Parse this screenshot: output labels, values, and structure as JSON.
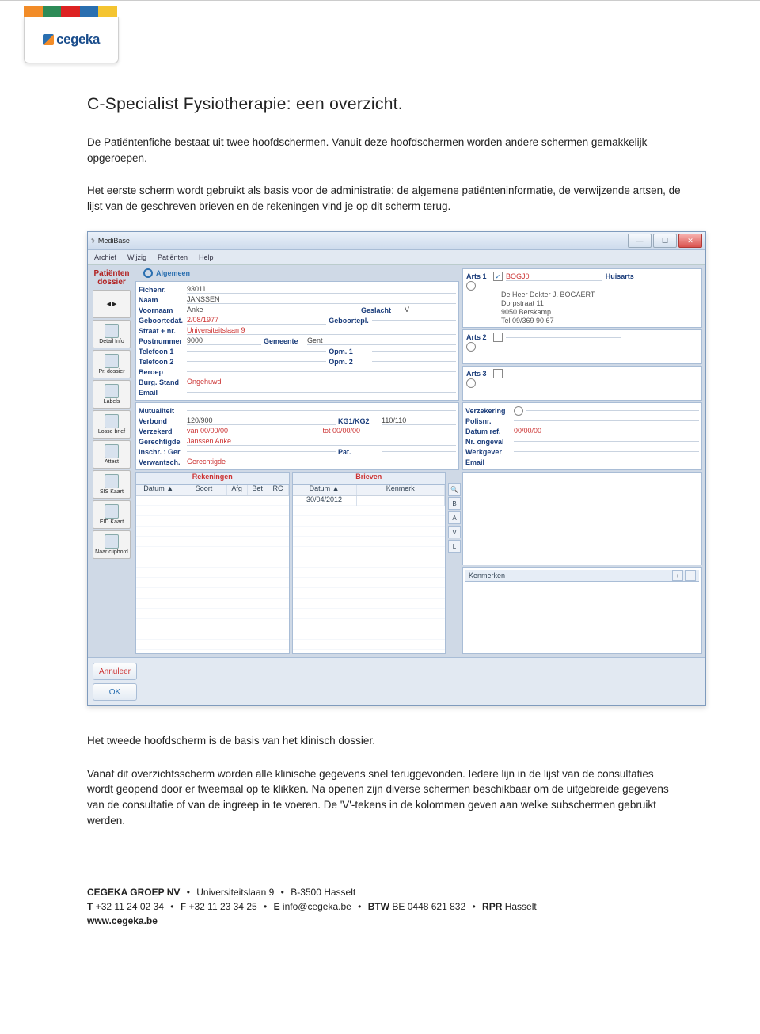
{
  "header": {
    "brand": "cegeka"
  },
  "document": {
    "title": "C-Specialist Fysiotherapie: een overzicht.",
    "intro": "De Patiëntenfiche bestaat uit twee hoofdschermen. Vanuit deze hoofdschermen worden andere schermen gemakkelijk opgeroepen.",
    "para": "Het eerste scherm wordt gebruikt als basis voor de administratie: de algemene patiënteninformatie, de verwijzende artsen, de lijst van de geschreven brieven en de rekeningen vind je op dit scherm terug.",
    "after1": "Het tweede hoofdscherm is de basis van het klinisch dossier.",
    "after2": "Vanaf dit overzichtsscherm worden alle klinische gegevens snel teruggevonden. Iedere lijn in de lijst van de consultaties wordt geopend door er tweemaal op te klikken. Na openen zijn diverse schermen beschikbaar om de uitgebreide gegevens van de consultatie of van de ingreep in te voeren. De 'V'-tekens in de kolommen geven aan welke subschermen gebruikt werden."
  },
  "footer": {
    "company": "CEGEKA GROEP NV",
    "address": "Universiteitslaan 9",
    "city": "B-3500 Hasselt",
    "phone_label": "T",
    "phone": "+32 11 24 02 34",
    "fax_label": "F",
    "fax": "+32 11 23 34 25",
    "email_label": "E",
    "email": "info@cegeka.be",
    "vat_label": "BTW",
    "vat": "BE 0448 621 832",
    "rpr_label": "RPR",
    "rpr": "Hasselt",
    "web": "www.cegeka.be"
  },
  "app": {
    "title": "MediBase",
    "menus": [
      "Archief",
      "Wijzig",
      "Patiënten",
      "Help"
    ],
    "rail_title": "Patiëntendossier",
    "rail": [
      "◀ ▶",
      "Detail Info",
      "Pr. dossier",
      "Labels",
      "Losse brief",
      "Attest",
      "SIS Kaart",
      "EID Kaart",
      "Naar clipbord"
    ],
    "section_general": "Algemeen",
    "form": {
      "fichenr_label": "Fichenr.",
      "fichenr": "93011",
      "naam_label": "Naam",
      "naam": "JANSSEN",
      "voornaam_label": "Voornaam",
      "voornaam": "Anke",
      "geslacht_label": "Geslacht",
      "geslacht": "V",
      "geboortedat_label": "Geboortedat.",
      "geboortedat": "2/08/1977",
      "geboortepl_label": "Geboortepl.",
      "geboortepl": "",
      "straat_label": "Straat + nr.",
      "straat": "Universiteitslaan 9",
      "postnummer_label": "Postnummer",
      "postnummer": "9000",
      "gemeente_label": "Gemeente",
      "gemeente": "Gent",
      "tel1_label": "Telefoon 1",
      "tel1": "",
      "opm1_label": "Opm. 1",
      "tel2_label": "Telefoon 2",
      "tel2": "",
      "opm2_label": "Opm. 2",
      "beroep_label": "Beroep",
      "burg_label": "Burg. Stand",
      "burg": "Ongehuwd",
      "email_label": "Email",
      "mutualiteit_label": "Mutualiteit",
      "verbond_label": "Verbond",
      "verbond": "120/900",
      "kg1_label": "KG1/KG2",
      "kg1": "110/110",
      "verzekerd_label": "Verzekerd",
      "verzekerd_van": "van  00/00/00",
      "verzekerd_tot": "tot  00/00/00",
      "gerechtigde_label": "Gerechtigde",
      "gerechtigde": "Janssen Anke",
      "inschr_label": "Inschr. : Ger",
      "pat_label": "Pat.",
      "verwantsch_label": "Verwantsch.",
      "verpeoples": "Gerechtigde"
    },
    "tables": {
      "rekeningen": {
        "title": "Rekeningen",
        "cols": [
          "Datum ▲",
          "Soort",
          "Afg",
          "Bet",
          "RC"
        ]
      },
      "brieven": {
        "title": "Brieven",
        "cols": [
          "Datum ▲",
          "Kenmerk"
        ],
        "row_date": "30/04/2012"
      },
      "side_buttons": [
        "🔍",
        "B",
        "A",
        "V",
        "L"
      ]
    },
    "doctors": {
      "arts1_label": "Arts 1",
      "arts1_code": "BOGJ0",
      "arts1_type": "Huisarts",
      "arts1_name": "De Heer Dokter J. BOGAERT",
      "arts1_addr1": "Dorpstraat 11",
      "arts1_addr2": "9050 Berskamp",
      "arts1_tel": "Tel 09/369 90 67",
      "arts2_label": "Arts 2",
      "arts3_label": "Arts 3"
    },
    "insurance": {
      "verzekering_label": "Verzekering",
      "polisnr_label": "Polisnr.",
      "datumref_label": "Datum ref.",
      "datumref": "00/00/00",
      "nrongeval_label": "Nr. ongeval",
      "werkgever_label": "Werkgever",
      "email_label": "Email"
    },
    "kenmerken_label": "Kenmerken",
    "buttons": {
      "cancel": "Annuleer",
      "ok": "OK"
    }
  }
}
